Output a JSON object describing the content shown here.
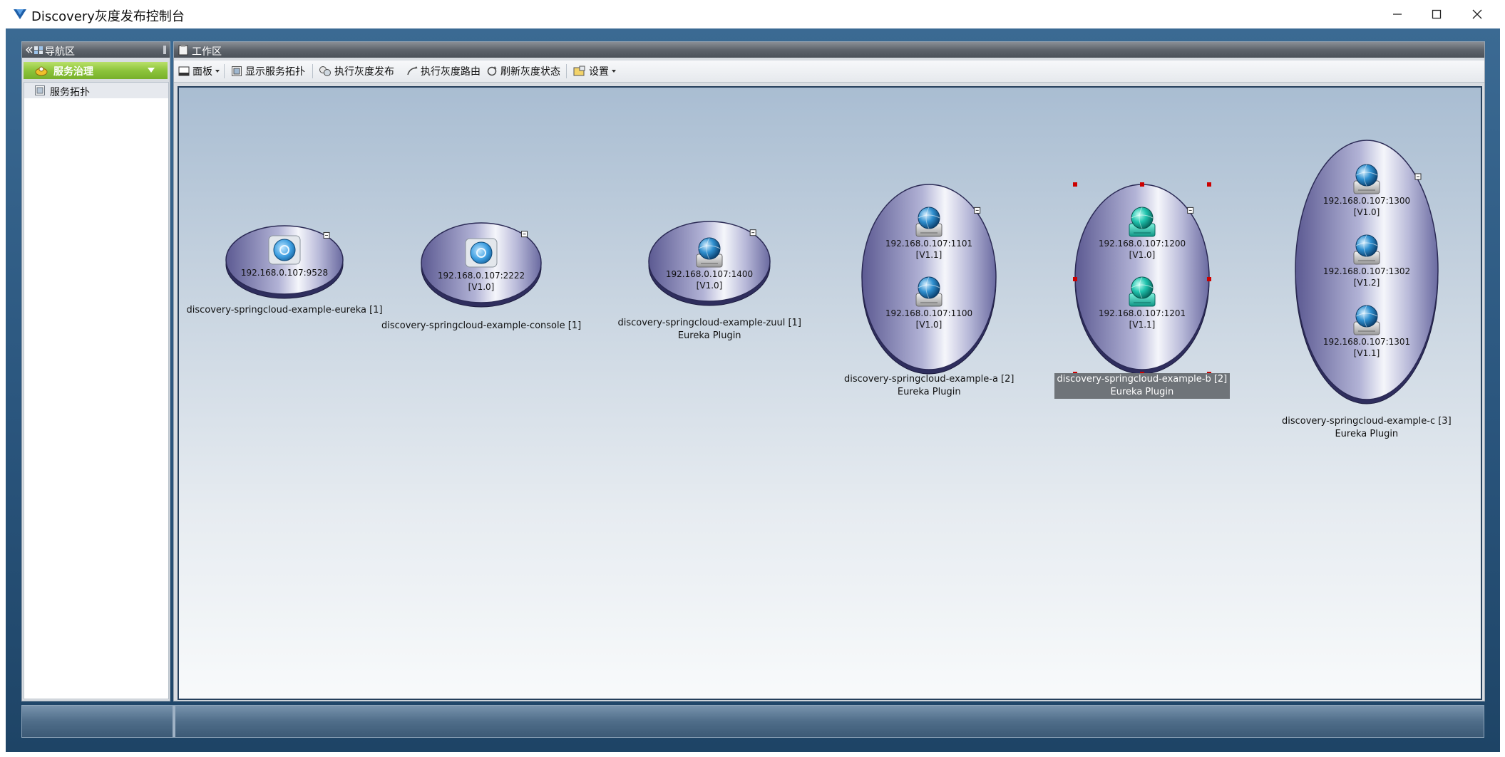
{
  "window": {
    "title": "Discovery灰度发布控制台",
    "controls": {
      "minimize": "—",
      "maximize": "☐",
      "close": "✕"
    }
  },
  "nav_panel": {
    "header": "导航区",
    "group": "服务治理",
    "items": [
      {
        "label": "服务拓扑"
      }
    ]
  },
  "work_panel": {
    "header": "工作区",
    "toolbar": [
      {
        "label": "面板",
        "icon": "panel-icon",
        "dropdown": true
      },
      {
        "label": "显示服务拓扑",
        "icon": "topology-icon"
      },
      {
        "label": "执行灰度发布",
        "icon": "gray-release-icon"
      },
      {
        "label": "执行灰度路由",
        "icon": "gray-route-icon"
      },
      {
        "label": "刷新灰度状态",
        "icon": "refresh-icon"
      },
      {
        "label": "设置",
        "icon": "settings-icon",
        "dropdown": true
      }
    ]
  },
  "topology": {
    "services": [
      {
        "name": "discovery-springcloud-example-eureka [1]",
        "plugin": "",
        "selected": false,
        "instances": [
          {
            "address": "192.168.0.107:9528",
            "version": "",
            "icon": "eureka-server-icon"
          }
        ]
      },
      {
        "name": "discovery-springcloud-example-console [1]",
        "plugin": "",
        "selected": false,
        "instances": [
          {
            "address": "192.168.0.107:2222",
            "version": "[V1.0]",
            "icon": "console-server-icon"
          }
        ]
      },
      {
        "name": "discovery-springcloud-example-zuul [1]",
        "plugin": "Eureka Plugin",
        "selected": false,
        "instances": [
          {
            "address": "192.168.0.107:1400",
            "version": "[V1.0]",
            "icon": "globe-server-icon"
          }
        ]
      },
      {
        "name": "discovery-springcloud-example-a [2]",
        "plugin": "Eureka Plugin",
        "selected": false,
        "instances": [
          {
            "address": "192.168.0.107:1101",
            "version": "[V1.1]",
            "icon": "globe-server-icon"
          },
          {
            "address": "192.168.0.107:1100",
            "version": "[V1.0]",
            "icon": "globe-server-icon"
          }
        ]
      },
      {
        "name": "discovery-springcloud-example-b [2]",
        "plugin": "Eureka Plugin",
        "selected": true,
        "instances": [
          {
            "address": "192.168.0.107:1200",
            "version": "[V1.0]",
            "icon": "teal-globe-server-icon"
          },
          {
            "address": "192.168.0.107:1201",
            "version": "[V1.1]",
            "icon": "teal-globe-server-icon"
          }
        ]
      },
      {
        "name": "discovery-springcloud-example-c [3]",
        "plugin": "Eureka Plugin",
        "selected": false,
        "instances": [
          {
            "address": "192.168.0.107:1300",
            "version": "[V1.0]",
            "icon": "globe-server-icon"
          },
          {
            "address": "192.168.0.107:1302",
            "version": "[V1.2]",
            "icon": "globe-server-icon"
          },
          {
            "address": "192.168.0.107:1301",
            "version": "[V1.1]",
            "icon": "globe-server-icon"
          }
        ]
      }
    ]
  },
  "colors": {
    "accent_green": "#8dc43b",
    "frame_blue": "#2a557d",
    "selection_red": "#cc0000"
  }
}
